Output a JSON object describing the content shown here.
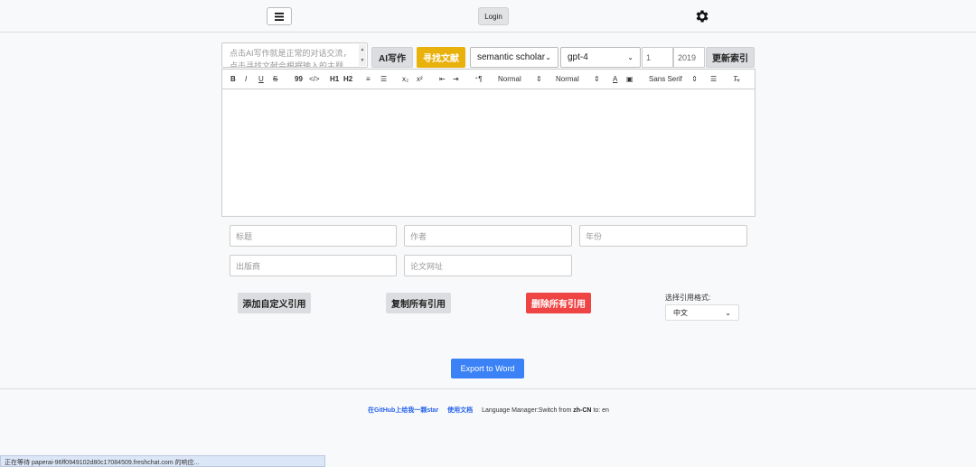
{
  "header": {
    "menu_icon": "hamburger-menu-icon",
    "login_label": "Login",
    "settings_icon": "gear-icon"
  },
  "composer": {
    "prompt_placeholder": "点击AI写作就是正常的对话交流，点击寻找文献会根据输入的主题",
    "ai_write_label": "AI写作",
    "find_refs_label": "寻找文献",
    "source_select": "semantic scholar",
    "model_select": "gpt-4",
    "count_value": "1",
    "year_value": "2019",
    "update_refs_label": "更新索引"
  },
  "toolbar": {
    "bold": "B",
    "italic": "I",
    "underline": "U",
    "strike": "S",
    "quote": "99",
    "code": "</>",
    "h1": "H1",
    "h2": "H2",
    "sub": "x₂",
    "sup": "x²",
    "rtl": "⁺¶",
    "size_select": "Normal",
    "header_select": "Normal",
    "font_select": "Sans Serif"
  },
  "reference_form": {
    "title_placeholder": "标题",
    "author_placeholder": "作者",
    "year_placeholder": "年份",
    "publisher_placeholder": "出版商",
    "url_placeholder": "论文网址"
  },
  "actions": {
    "add_custom_label": "添加自定义引用",
    "copy_all_label": "复制所有引用",
    "delete_all_label": "删除所有引用",
    "cite_format_label": "选择引用格式:",
    "cite_format_value": "中文"
  },
  "export_label": "Export to Word",
  "footer": {
    "github_link": "在GitHub上给我一颗star",
    "docs_link": "使用文档",
    "lang_prefix": "Language Manager:Switch from",
    "lang_from": "zh-CN",
    "lang_to_text": "to: en"
  },
  "status_bar": "正在等待 paperai-96ff0949102d80c17084509.freshchat.com 的响应..."
}
